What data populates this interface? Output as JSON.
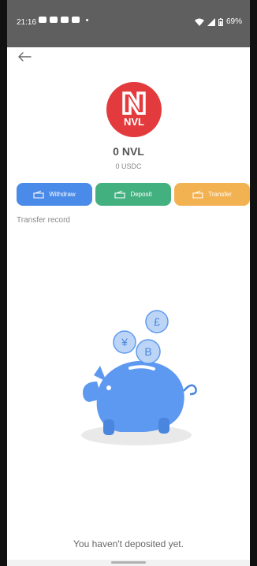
{
  "status_bar": {
    "time": "21:16",
    "battery": "69%"
  },
  "header": {
    "back_icon": "arrow-left-icon"
  },
  "token": {
    "logo_text": "NVL",
    "amount": "0 NVL",
    "fiat_amount": "0 USDC",
    "brand_color": "#e23a3d"
  },
  "actions": {
    "withdraw_label": "Withdraw",
    "deposit_label": "Deposit",
    "transfer_label": "Transfer",
    "withdraw_color": "#4a8ae9",
    "deposit_color": "#43b07f",
    "transfer_color": "#f3b251"
  },
  "section": {
    "title": "Transfer record"
  },
  "empty_state": {
    "message": "You haven't deposited yet.",
    "coins": [
      "£",
      "¥",
      "B"
    ]
  }
}
